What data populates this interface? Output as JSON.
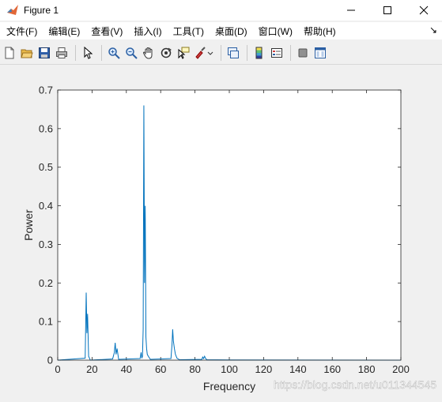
{
  "window": {
    "title": "Figure 1"
  },
  "menu": {
    "items": [
      {
        "label": "文件(F)"
      },
      {
        "label": "编辑(E)"
      },
      {
        "label": "查看(V)"
      },
      {
        "label": "插入(I)"
      },
      {
        "label": "工具(T)"
      },
      {
        "label": "桌面(D)"
      },
      {
        "label": "窗口(W)"
      },
      {
        "label": "帮助(H)"
      }
    ]
  },
  "toolbar": {
    "icons": [
      "new-figure-icon",
      "open-file-icon",
      "save-icon",
      "print-icon",
      "edit-plot-arrow-icon",
      "zoom-in-icon",
      "zoom-out-icon",
      "pan-hand-icon",
      "rotate-3d-icon",
      "data-cursor-icon",
      "brush-icon",
      "link-plot-icon",
      "colorbar-icon",
      "legend-icon",
      "hide-plot-tools-icon",
      "show-plot-tools-icon"
    ]
  },
  "chart_data": {
    "type": "line",
    "title": "",
    "xlabel": "Frequency",
    "ylabel": "Power",
    "xlim": [
      0,
      200
    ],
    "ylim": [
      0,
      0.7
    ],
    "xticks": [
      0,
      20,
      40,
      60,
      80,
      100,
      120,
      140,
      160,
      180,
      200
    ],
    "yticks": [
      0,
      0.1,
      0.2,
      0.3,
      0.4,
      0.5,
      0.6,
      0.7
    ],
    "line_color": "#0072bd",
    "grid": false,
    "series": [
      {
        "x": [
          0,
          16,
          16.6,
          17,
          17.4,
          18,
          19,
          32,
          33,
          33.5,
          34,
          34.6,
          35.5,
          48,
          48.6,
          49,
          49.4,
          49.8,
          50.2,
          50.6,
          51,
          51.4,
          51.8,
          52.2,
          52.8,
          54,
          66,
          66.6,
          67,
          67.4,
          68,
          68.6,
          69.5,
          71,
          84,
          84.5,
          85,
          85.6,
          86.2,
          87,
          100,
          200
        ],
        "y": [
          0,
          0.005,
          0.175,
          0.07,
          0.12,
          0.01,
          0,
          0.003,
          0.02,
          0.045,
          0.015,
          0.03,
          0.002,
          0.004,
          0.02,
          0.005,
          0.01,
          0.08,
          0.66,
          0.2,
          0.4,
          0.06,
          0.03,
          0.015,
          0.01,
          0.002,
          0.004,
          0.04,
          0.08,
          0.05,
          0.03,
          0.015,
          0.005,
          0.001,
          0.002,
          0.008,
          0.004,
          0.01,
          0.004,
          0.001,
          0.0005,
          0
        ]
      }
    ]
  },
  "watermark": {
    "text": "https://blog.csdn.net/u011344545"
  }
}
